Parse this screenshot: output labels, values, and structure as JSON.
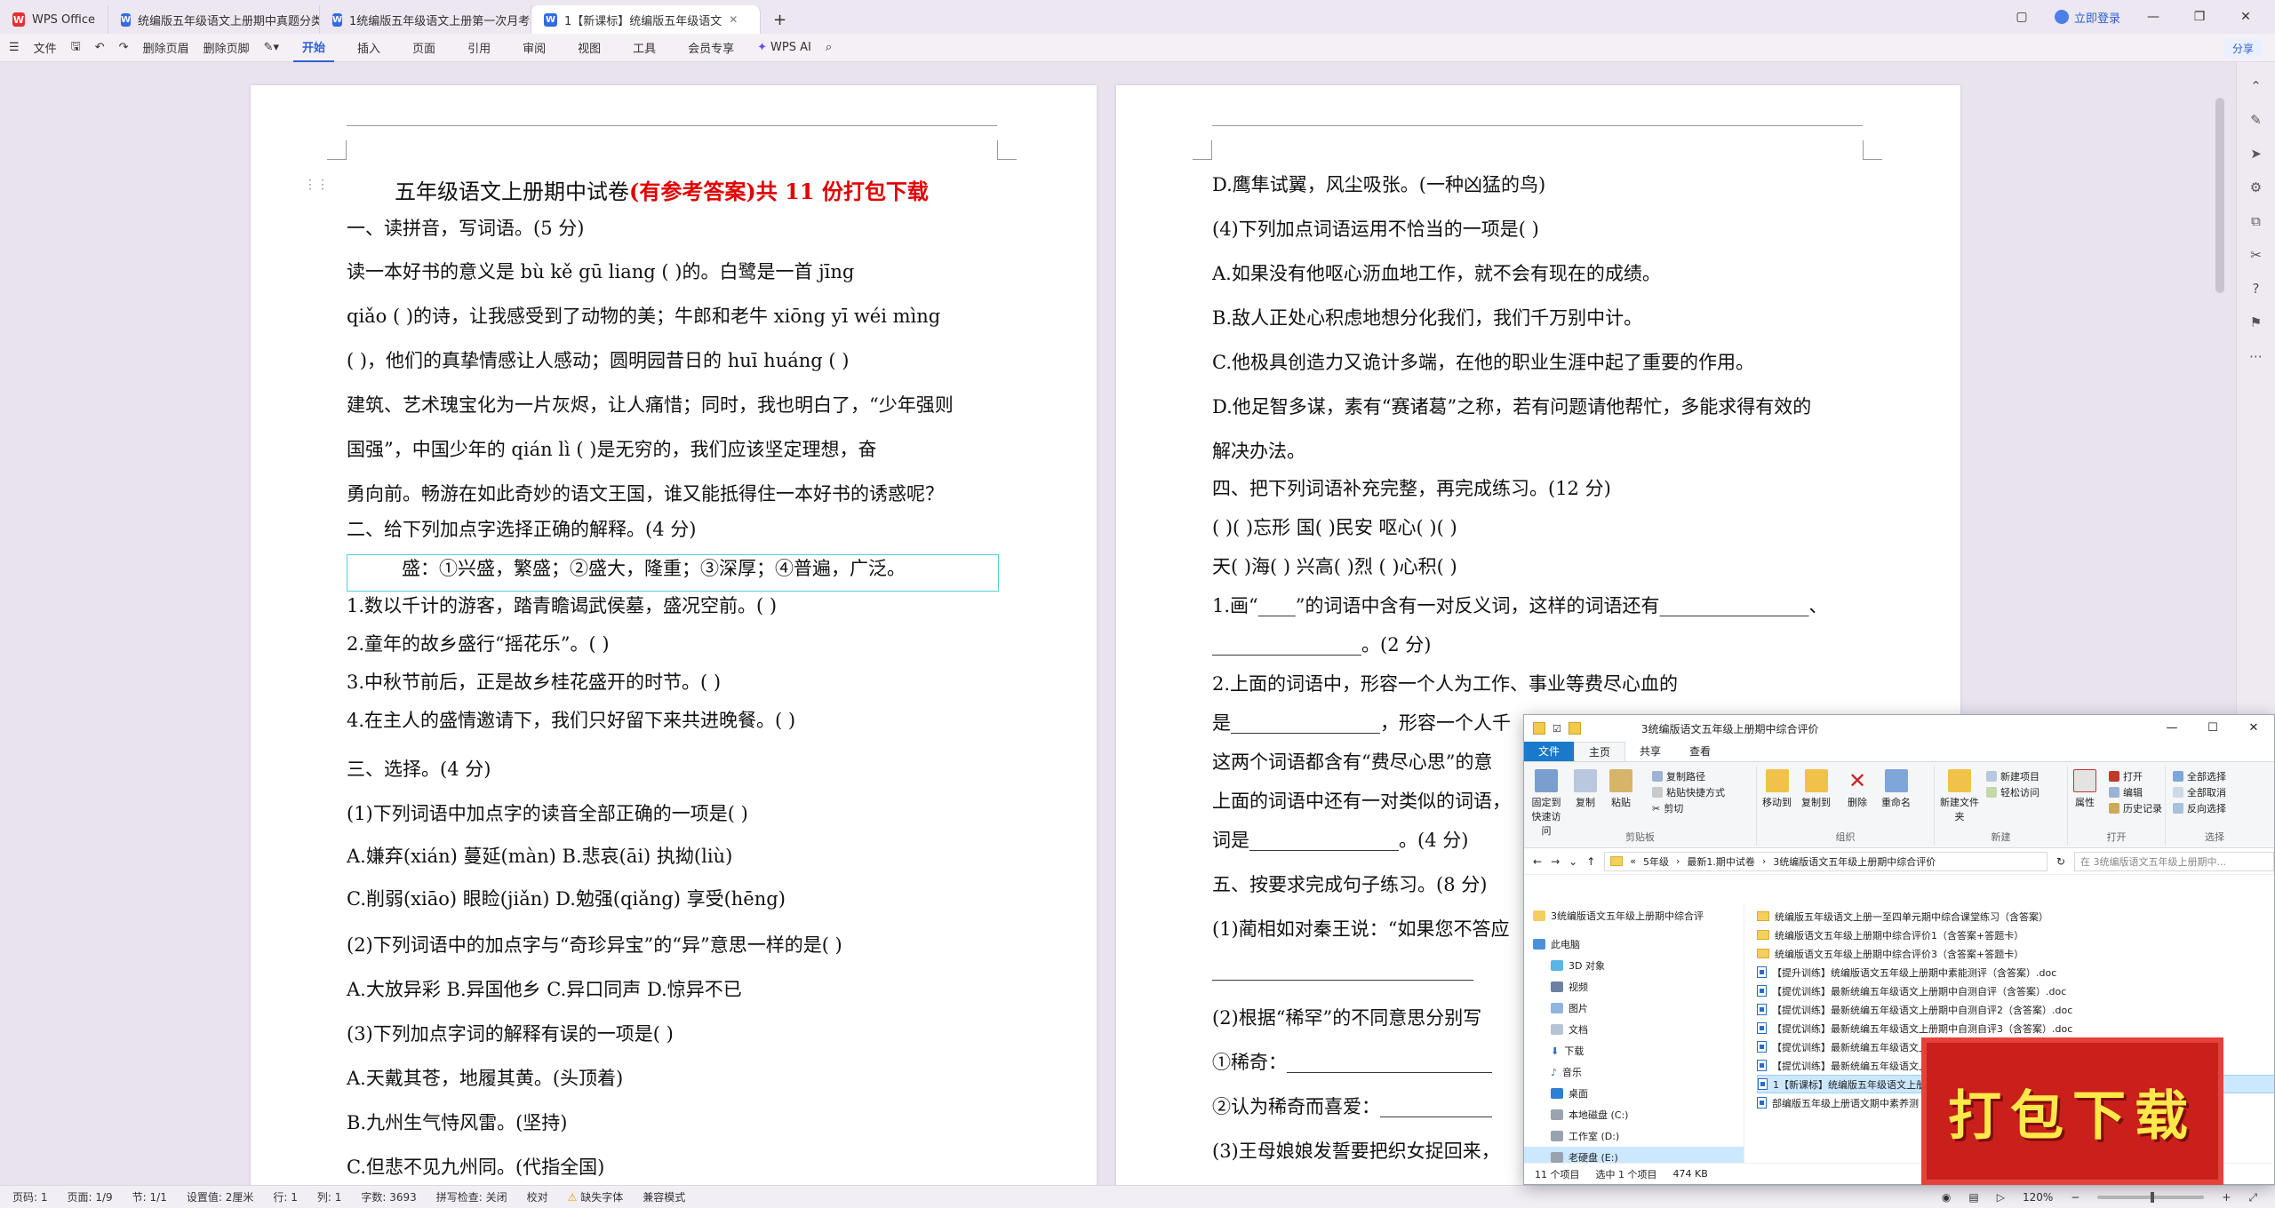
{
  "tabs": [
    {
      "label": "WPS Office"
    },
    {
      "label": "统编版五年级语文上册期中真题分类"
    },
    {
      "label": "1统编版五年级语文上册第一次月考检"
    },
    {
      "label": "1【新课标】统编版五年级语文"
    }
  ],
  "titlebar": {
    "login_label": "立即登录",
    "new_tab": "+"
  },
  "ribbon": {
    "file_menu": "文件",
    "delete_header": "删除页眉",
    "delete_footer": "删除页脚",
    "tabs": [
      "开始",
      "插入",
      "页面",
      "引用",
      "审阅",
      "视图",
      "工具",
      "会员专享"
    ],
    "wps_ai": "WPS AI",
    "share": "分享"
  },
  "page1": {
    "title_black": "五年级语文上册期中试卷",
    "title_red": "(有参考答案)共 11 份打包下载",
    "lines": [
      "一、读拼音，写词语。(5 分)",
      "读一本好书的意义是 bù kě gū liang (          )的。白鹭是一首 jīng",
      "qiǎo (      )的诗，让我感受到了动物的美；牛郎和老牛 xiōng yī wéi mìng",
      "(          )，他们的真挚情感让人感动；圆明园昔日的 huī huáng (      )",
      "建筑、艺术瑰宝化为一片灰烬，让人痛惜；同时，我也明白了，“少年强则",
      "国强”，中国少年的 qián lì (      )是无穷的，我们应该坚定理想，奋",
      "勇向前。畅游在如此奇妙的语文王国，谁又能抵得住一本好书的诱惑呢？",
      "二、给下列加点字选择正确的解释。(4 分)",
      "盛：①兴盛，繁盛；②盛大，隆重；③深厚；④普遍，广泛。",
      "1.数以千计的游客，踏青瞻谒武侯墓，盛况空前。(    )",
      "2.童年的故乡盛行“摇花乐”。(    )",
      "3.中秋节前后，正是故乡桂花盛开的时节。(    )",
      "4.在主人的盛情邀请下，我们只好留下来共进晚餐。(    )",
      "三、选择。(4 分)",
      "(1)下列词语中加点字的读音全部正确的一项是(    )",
      "A.嫌弃(xián)   蔓延(màn)    B.悲哀(āi)      执拗(liù)",
      "C.削弱(xiāo)   眼睑(jiǎn)   D.勉强(qiǎng)   享受(hēng)",
      "(2)下列词语中的加点字与“奇珍异宝”的“异”意思一样的是(    )",
      "A.大放异彩      B.异国他乡      C.异口同声      D.惊异不已",
      "(3)下列加点字词的解释有误的一项是(    )",
      "A.天戴其苍，地履其黄。(头顶着)",
      "B.九州生气恃风雷。(坚持)",
      "C.但悲不见九州同。(代指全国)"
    ]
  },
  "page2": {
    "lines": [
      "D.鹰隼试翼，风尘吸张。(一种凶猛的鸟)",
      "(4)下列加点词语运用不恰当的一项是(    )",
      "A.如果没有他呕心沥血地工作，就不会有现在的成绩。",
      "B.敌人正处心积虑地想分化我们，我们千万别中计。",
      "C.他极具创造力又诡计多端，在他的职业生涯中起了重要的作用。",
      "D.他足智多谋，素有“赛诸葛”之称，若有问题请他帮忙，多能求得有效的",
      "解决办法。",
      "四、把下列词语补充完整，再完成练习。(12 分)",
      "(    )(    )忘形        国(    )民安        呕心(    )(    )",
      "天(    )海(    )        兴高(    )烈        (    )心积(    )",
      "1.画“____”的词语中含有一对反义词，这样的词语还有________________、",
      "________________。(2 分)",
      "2.上面的词语中，形容一个人为工作、事业等费尽心血的",
      "是________________，形容一个人千",
      "这两个词语都含有“费尽心思”的意",
      "上面的词语中还有一对类似的词语，",
      "词是________________。(4 分)",
      "五、按要求完成句子练习。(8 分)",
      "(1)蔺相如对秦王说：“如果您不答应",
      "____________________________",
      "(2)根据“稀罕”的不同意思分别写",
      "①稀奇：______________________",
      "②认为稀奇而喜爱：____________",
      "(3)王母娘娘发誓要把织女捉回来，"
    ]
  },
  "statusbar": {
    "items": [
      "页码: 1",
      "页面: 1/9",
      "节: 1/1",
      "设置值: 2厘米",
      "行: 1",
      "列: 1",
      "字数: 3693",
      "拼写检查: 关闭",
      "校对",
      "缺失字体",
      "兼容模式"
    ],
    "zoom": "120%"
  },
  "explorer": {
    "title": "3统编版语文五年级上册期中综合评价",
    "tabs": [
      "文件",
      "主页",
      "共享",
      "查看"
    ],
    "ribbon": {
      "pin_label": "固定到快速访问",
      "copy_label": "复制",
      "paste_label": "粘贴",
      "copy_path": "复制路径",
      "paste_shortcut": "粘贴快捷方式",
      "cut": "剪切",
      "clipboard_group": "剪贴板",
      "move_to": "移动到",
      "copy_to": "复制到",
      "delete": "删除",
      "rename": "重命名",
      "organize_group": "组织",
      "new_folder": "新建文件夹",
      "new_item": "新建项目",
      "easy_access": "轻松访问",
      "new_group": "新建",
      "properties": "属性",
      "open": "打开",
      "edit": "编辑",
      "history": "历史记录",
      "open_group": "打开",
      "select_all": "全部选择",
      "select_none": "全部取消",
      "invert_select": "反向选择",
      "select_group": "选择"
    },
    "address": [
      "5年级",
      "最新1.期中试卷",
      "3统编版语文五年级上册期中综合评价"
    ],
    "search_placeholder": "在 3统编版语文五年级上册期中...",
    "nav": [
      "3统编版语文五年级上册期中综合评",
      "此电脑",
      "3D 对象",
      "视频",
      "图片",
      "文档",
      "下载",
      "音乐",
      "桌面",
      "本地磁盘 (C:)",
      "工作室 (D:)",
      "老硬盘 (E:)"
    ],
    "files": [
      "统编版五年级语文上册一至四单元期中综合课堂练习（含答案）",
      "统编版语文五年级上册期中综合评价1（含答案+答题卡）",
      "统编版语文五年级上册期中综合评价3（含答案+答题卡）",
      "【提升训练】统编版语文五年级上册期中素能测评（含答案）.doc",
      "【提优训练】最新统编五年级语文上册期中自测自评（含答案）.doc",
      "【提优训练】最新统编五年级语文上册期中自测自评2（含答案）.doc",
      "【提优训练】最新统编五年级语文上册期中自测自评3（含答案）.doc",
      "【提优训练】最新统编五年级语文上册期中自测自评4（含答案）.doc",
      "【提优训练】最新统编五年级语文上册期中自测自评5（含答案）.doc",
      "1【新课标】统编版五年级语文上册期中",
      "部编版五年级上册语文期中素养测"
    ],
    "status": [
      "11 个项目",
      "选中 1 个项目",
      "474 KB"
    ]
  },
  "stamp": {
    "text": "打包下载"
  },
  "colors": {
    "accent": "#2f5fd0",
    "title_red": "#e00000",
    "stamp_red": "#c9201b",
    "stamp_yellow": "#ffe94a",
    "explorer_blue": "#1979ca"
  }
}
